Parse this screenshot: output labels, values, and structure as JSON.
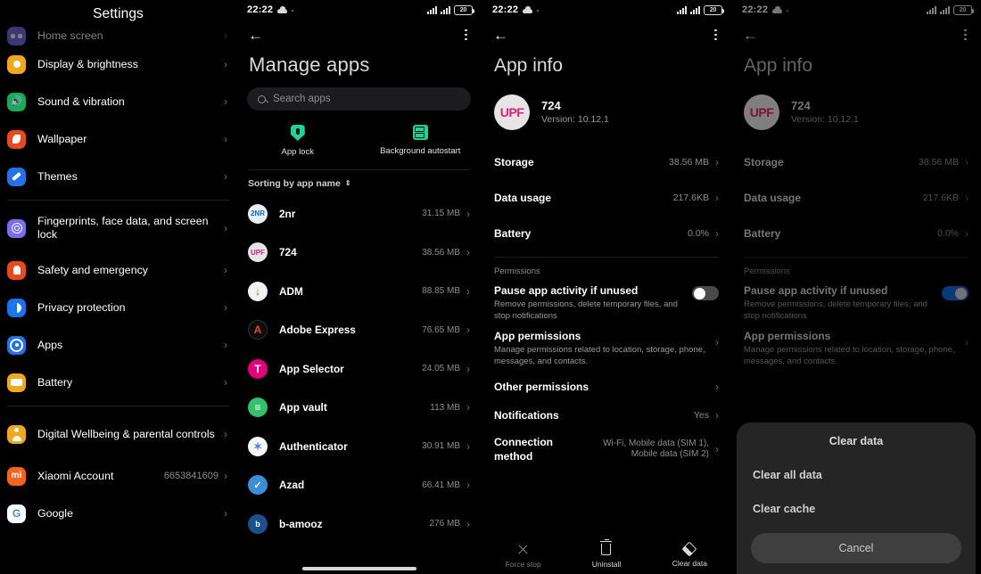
{
  "statusbar": {
    "time": "22:22",
    "battery_level": "20",
    "cloud_icon": "cloud-icon",
    "signal_icon": "signal-bars-icon"
  },
  "settings_panel": {
    "title": "Settings",
    "groups": [
      {
        "items": [
          {
            "label": "Home screen",
            "icon": "home-screen-icon",
            "color": "#7a6ef0",
            "glyph": "g-home",
            "value": "",
            "faded": true
          },
          {
            "label": "Display & brightness",
            "icon": "display-brightness-icon",
            "color": "#f0a81e",
            "glyph": "g-sun",
            "value": ""
          },
          {
            "label": "Sound & vibration",
            "icon": "sound-vibration-icon",
            "color": "#1aa85a",
            "glyph": "g-speaker",
            "value": ""
          },
          {
            "label": "Wallpaper",
            "icon": "wallpaper-icon",
            "color": "#e8491f",
            "glyph": "g-wall",
            "value": ""
          },
          {
            "label": "Themes",
            "icon": "themes-icon",
            "color": "#2572e8",
            "glyph": "g-theme",
            "value": ""
          }
        ]
      },
      {
        "items": [
          {
            "label": "Fingerprints, face data, and screen lock",
            "icon": "fingerprint-icon",
            "color": "#7a6ef0",
            "glyph": "g-finger",
            "value": "",
            "tall": true
          },
          {
            "label": "Safety and emergency",
            "icon": "safety-emergency-icon",
            "color": "#e8491f",
            "glyph": "g-safety",
            "value": ""
          },
          {
            "label": "Privacy protection",
            "icon": "privacy-protection-icon",
            "color": "#1a73e8",
            "glyph": "g-privacy",
            "value": ""
          },
          {
            "label": "Apps",
            "icon": "apps-icon",
            "color": "#2572e8",
            "glyph": "g-apps",
            "value": ""
          },
          {
            "label": "Battery",
            "icon": "battery-icon",
            "color": "#f0a81e",
            "glyph": "g-batt",
            "value": ""
          }
        ]
      },
      {
        "items": [
          {
            "label": "Digital Wellbeing & parental controls",
            "icon": "digital-wellbeing-icon",
            "color": "#f0a81e",
            "glyph": "g-wellbeing",
            "value": "",
            "tall": true
          },
          {
            "label": "Xiaomi Account",
            "icon": "xiaomi-account-icon",
            "color": "#f4641e",
            "glyph": "g-mi",
            "glyph_text": "mi",
            "value": "6653841609"
          },
          {
            "label": "Google",
            "icon": "google-icon",
            "color": "#ffffff",
            "glyph": "g-google",
            "glyph_text": "G",
            "value": ""
          }
        ]
      }
    ]
  },
  "manage_apps_panel": {
    "title": "Manage apps",
    "back_icon": "back-arrow-icon",
    "menu_icon": "kebab-menu-icon",
    "search": {
      "placeholder": "Search apps",
      "value": "",
      "icon": "search-icon"
    },
    "shortcuts": [
      {
        "label": "App lock",
        "icon": "app-lock-shield-icon"
      },
      {
        "label": "Background autostart",
        "icon": "background-autostart-icon"
      }
    ],
    "sort_label": "Sorting by app name",
    "sort_icon": "sort-toggle-icon",
    "apps": [
      {
        "name": "2nr",
        "size": "31.15 MB",
        "icon_bg": "#e8eef5",
        "icon_fg": "#1d63b5",
        "icon_text": "2NR",
        "icon": "app-icon-2nr"
      },
      {
        "name": "724",
        "size": "38.56 MB",
        "icon_bg": "#e6e4e4",
        "icon_fg": "#e0216f",
        "icon_text": "UPF",
        "icon": "app-icon-724"
      },
      {
        "name": "ADM",
        "size": "88.85 MB",
        "icon_bg": "#f2f2f2",
        "icon_fg": "#2db34a",
        "icon_text": "↓",
        "icon": "app-icon-adm"
      },
      {
        "name": "Adobe Express",
        "size": "76.65 MB",
        "icon_bg": "#0d0d0d",
        "icon_fg": "#e8472c",
        "icon_text": "A",
        "icon": "app-icon-adobe-express"
      },
      {
        "name": "App Selector",
        "size": "24.05 MB",
        "icon_bg": "#e2007a",
        "icon_fg": "#ffffff",
        "icon_text": "T",
        "icon": "app-icon-app-selector"
      },
      {
        "name": "App vault",
        "size": "113 MB",
        "icon_bg": "#33c06a",
        "icon_fg": "#ffffff",
        "icon_text": "≡",
        "icon": "app-icon-app-vault"
      },
      {
        "name": "Authenticator",
        "size": "30.91 MB",
        "icon_bg": "#f7f7f7",
        "icon_fg": "#4285f4",
        "icon_text": "✶",
        "icon": "app-icon-authenticator"
      },
      {
        "name": "Azad",
        "size": "66.41 MB",
        "icon_bg": "#3b8fd6",
        "icon_fg": "#ffffff",
        "icon_text": "✓",
        "icon": "app-icon-azad"
      },
      {
        "name": "b-amooz",
        "size": "276 MB",
        "icon_bg": "#1d4f8c",
        "icon_fg": "#ffffff",
        "icon_text": "b",
        "icon": "app-icon-b-amooz"
      }
    ]
  },
  "app_info": {
    "title": "App info",
    "back_icon": "back-arrow-icon",
    "menu_icon": "kebab-menu-icon",
    "app_name": "724",
    "app_icon_text": "UPF",
    "app_version": "Version: 10.12.1",
    "rows": [
      {
        "key": "Storage",
        "value": "38.56 MB"
      },
      {
        "key": "Data usage",
        "value": "217.6KB"
      },
      {
        "key": "Battery",
        "value": "0.0%"
      }
    ],
    "permissions_section": "Permissions",
    "pause_activity": {
      "title": "Pause app activity if unused",
      "subtitle": "Remove permissions, delete temporary files, and stop notifications",
      "toggle_on_panel3": false,
      "toggle_on_panel4": true
    },
    "app_permissions": {
      "title": "App permissions",
      "subtitle": "Manage permissions related to location, storage, phone, messages, and contacts.",
      "subtitle_short": "Manage permissions related to location, storage,"
    },
    "other_permissions": {
      "title": "Other permissions"
    },
    "notifications": {
      "key": "Notifications",
      "value": "Yes"
    },
    "connection_method": {
      "key": "Connection method",
      "value": "Wi-Fi, Mobile data (SIM 1), Mobile data (SIM 2)"
    },
    "actions": [
      {
        "label": "Force stop",
        "icon": "force-stop-x-icon",
        "dim": true
      },
      {
        "label": "Uninstall",
        "icon": "uninstall-trash-icon",
        "dim": false
      },
      {
        "label": "Clear data",
        "icon": "clear-data-eraser-icon",
        "dim": false
      }
    ]
  },
  "clear_data_dialog": {
    "title": "Clear data",
    "options": [
      "Clear all data",
      "Clear cache"
    ],
    "cancel_label": "Cancel"
  },
  "colors": {
    "accent_blue": "#1268d6",
    "accent_green": "#1ed39a",
    "brand_pink": "#e0216f"
  }
}
